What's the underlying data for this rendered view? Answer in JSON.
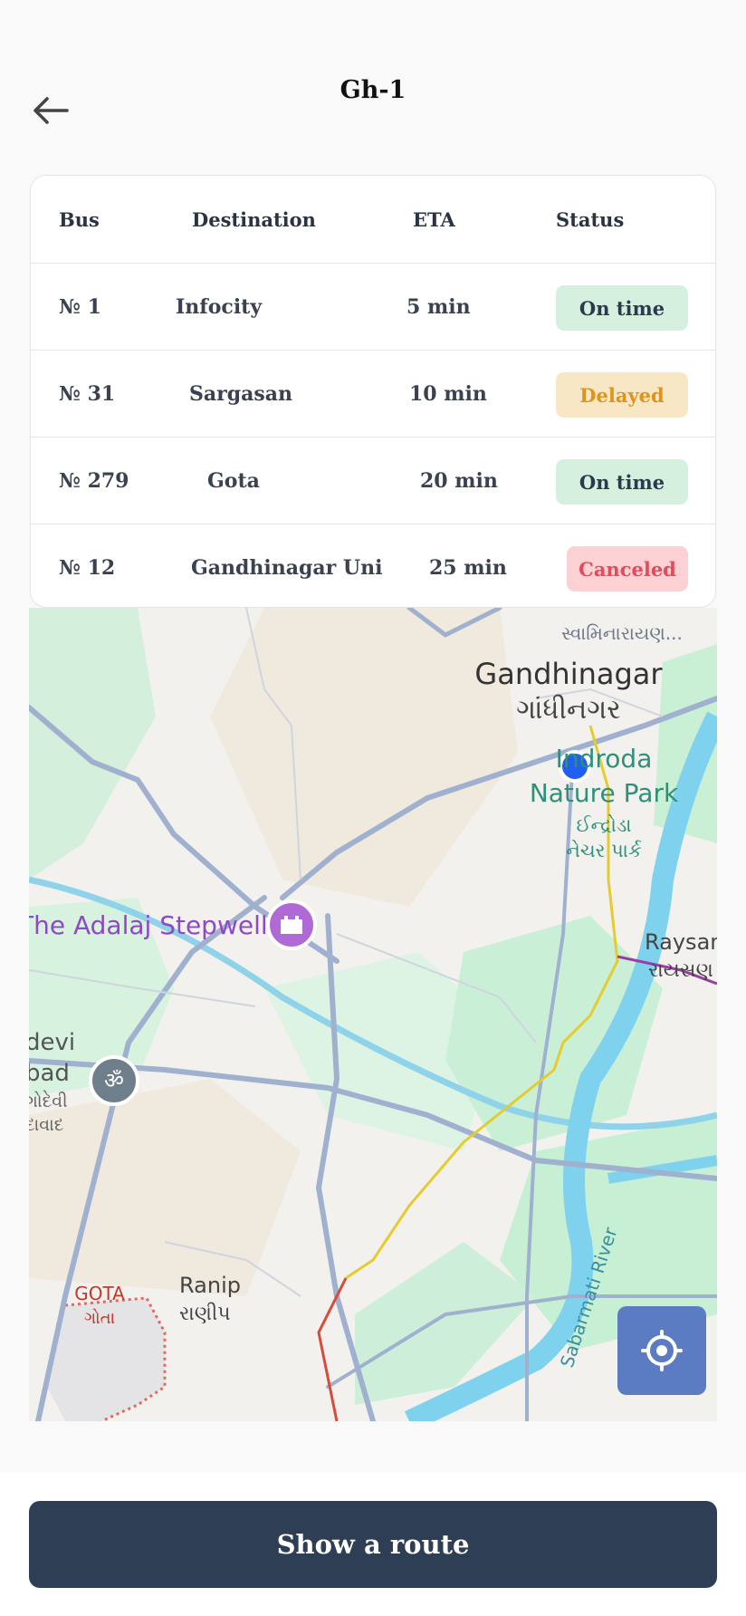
{
  "header": {
    "title": "Gh-1"
  },
  "table": {
    "columns": [
      "Bus",
      "Destination",
      "ETA",
      "Status"
    ],
    "rows": [
      {
        "bus": "№ 1",
        "destination": "Infocity",
        "eta": "5 min",
        "status": "On time",
        "status_type": "ontime"
      },
      {
        "bus": "№ 31",
        "destination": "Sargasan",
        "eta": "10 min",
        "status": "Delayed",
        "status_type": "delayed"
      },
      {
        "bus": "№ 279",
        "destination": "Gota",
        "eta": "20 min",
        "status": "On time",
        "status_type": "ontime"
      },
      {
        "bus": "№ 12",
        "destination": "Gandhinagar Uni",
        "eta": "25 min",
        "status": "Canceled",
        "status_type": "canceled"
      }
    ]
  },
  "map": {
    "labels": {
      "swaminarayan": "સ્વામિનારાયણ...",
      "gandhinagar_en": "Gandhinagar",
      "gandhinagar_gu": "ગાંધીનગર",
      "indroda_1": "Indroda",
      "indroda_2": "Nature Park",
      "indroda_gu_1": "ઈન્દ્રોડા",
      "indroda_gu_2": "નેચર પાર્ક",
      "adalaj": "The Adalaj Stepwell",
      "raysan_en": "Raysan",
      "raysan_gu": "રાયસણ",
      "devi_1": "devi",
      "devi_2": "bad",
      "devi_gu_1": "ગોદેવી",
      "devi_gu_2": "દાવાદ",
      "gota_en": "GOTA",
      "gota_gu": "ગોતા",
      "ranip_en": "Ranip",
      "ranip_gu": "રાણીપ",
      "river": "Sabarmati River"
    },
    "locate_icon": "crosshair-icon"
  },
  "footer": {
    "route_button": "Show a route"
  },
  "colors": {
    "ontime_bg": "#d6f0e0",
    "delayed_bg": "#f8e7c5",
    "delayed_text": "#e0941e",
    "canceled_bg": "#fcd1d3",
    "canceled_text": "#e34a5a",
    "button_bg": "#2e3e54",
    "locate_bg": "#5b7bc3"
  }
}
